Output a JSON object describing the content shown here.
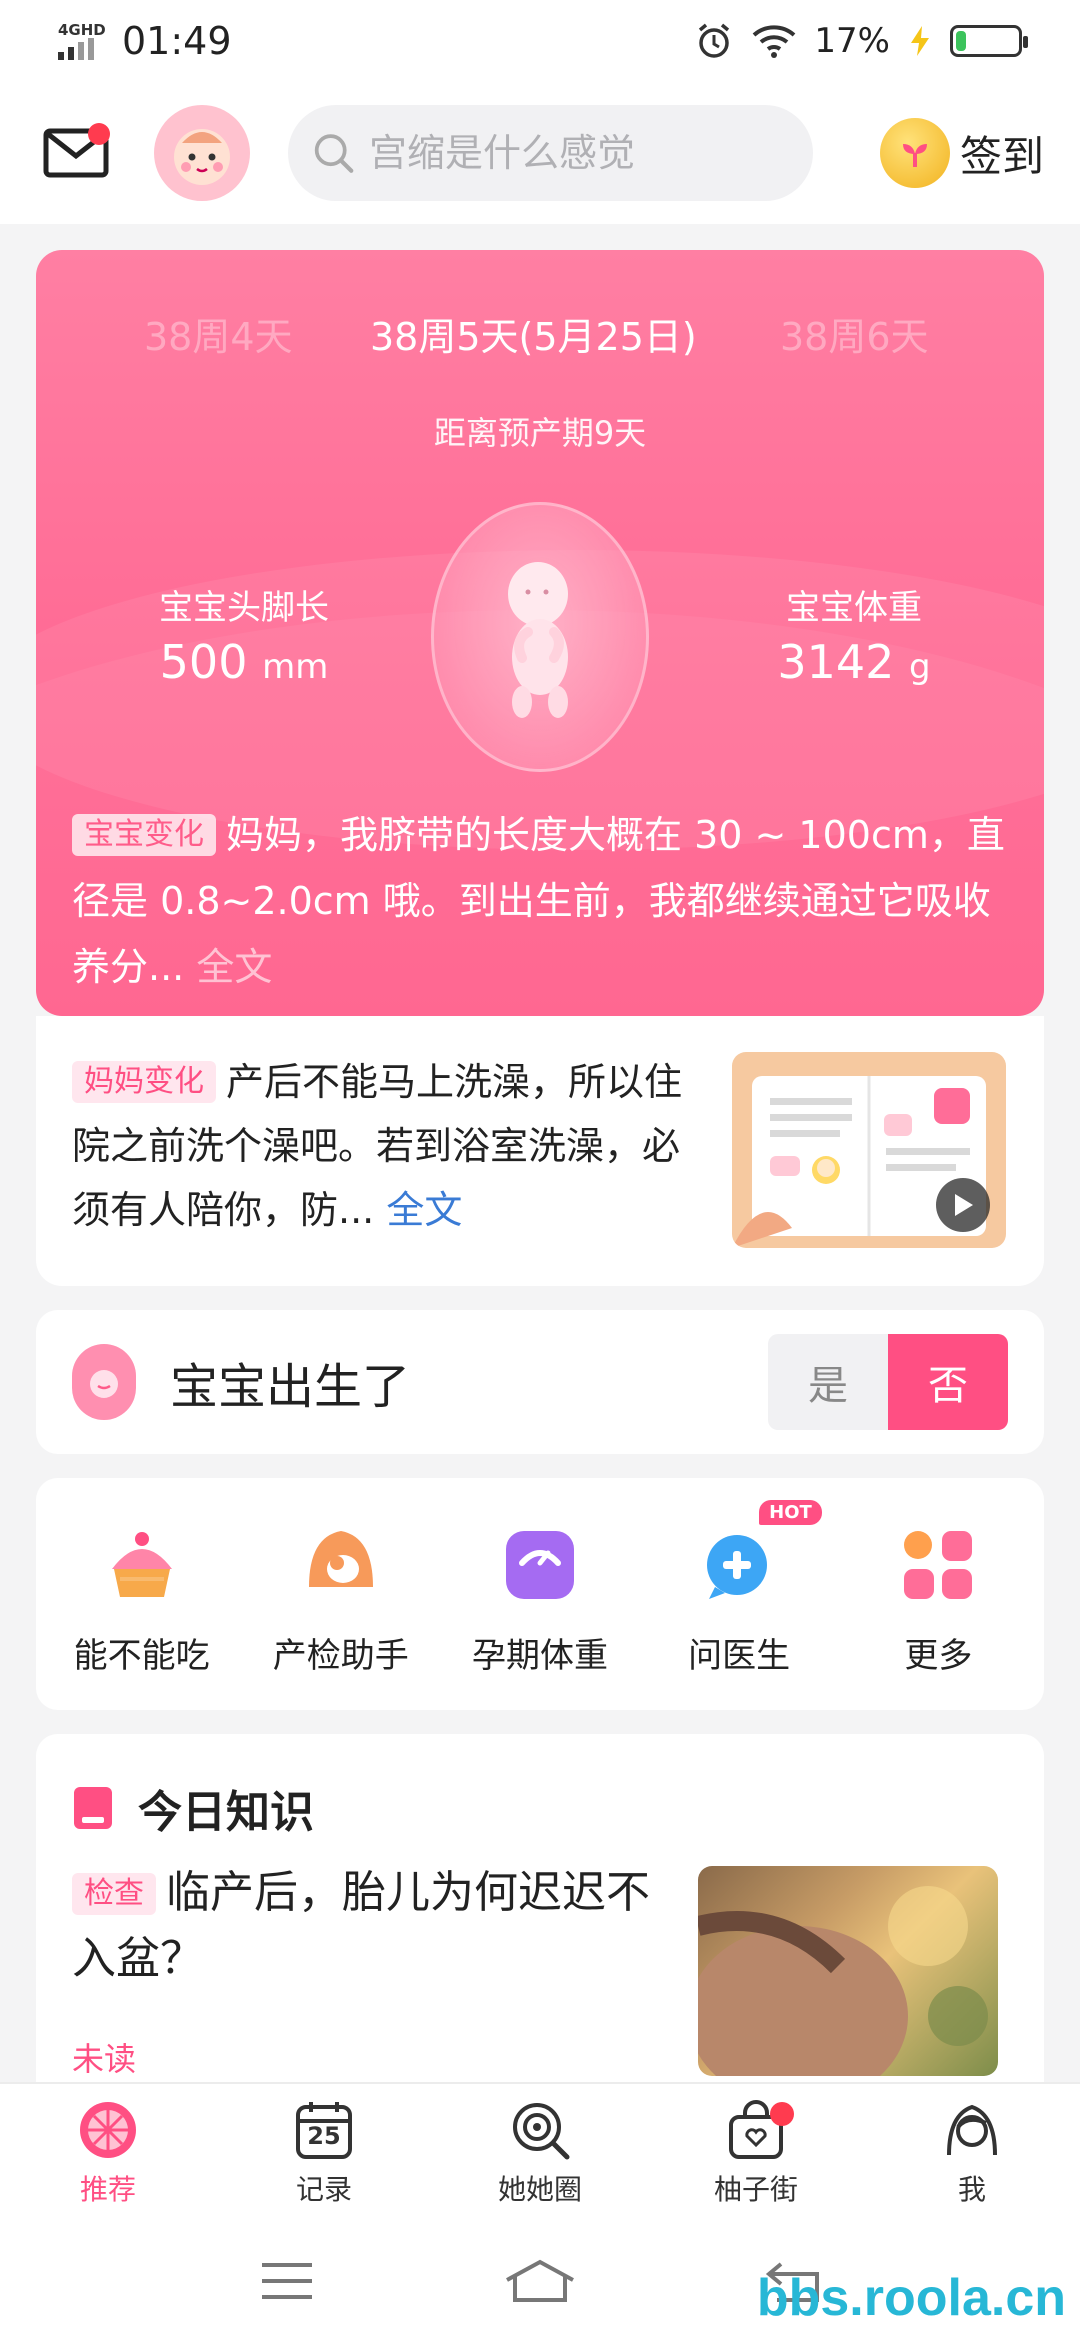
{
  "status_bar": {
    "network": "4GHD",
    "time": "01:49",
    "battery_percent": "17%",
    "battery_level": 0.17
  },
  "header": {
    "search_placeholder": "宫缩是什么感觉",
    "checkin_label": "签到"
  },
  "hero": {
    "prev_week": "38周4天",
    "current_week": "38周5天(5月25日)",
    "next_week": "38周6天",
    "due_countdown": "距离预产期9天",
    "length_label": "宝宝头脚长",
    "length_value": "500",
    "length_unit": "mm",
    "weight_label": "宝宝体重",
    "weight_value": "3142",
    "weight_unit": "g",
    "tag": "宝宝变化",
    "text": "妈妈，我脐带的长度大概在 30 ~ 100cm，直径是 0.8~2.0cm 哦。到出生前，我都继续通过它吸收养分...",
    "more": "全文"
  },
  "mom_change": {
    "tag": "妈妈变化",
    "text": "产后不能马上洗澡，所以住院之前洗个澡吧。若到浴室洗澡，必须有人陪你，防...",
    "more": "全文"
  },
  "born": {
    "label": "宝宝出生了",
    "yes": "是",
    "no": "否"
  },
  "tools": [
    {
      "label": "能不能吃",
      "icon": "cake-icon"
    },
    {
      "label": "产检助手",
      "icon": "ultrasound-icon"
    },
    {
      "label": "孕期体重",
      "icon": "scale-icon"
    },
    {
      "label": "问医生",
      "icon": "doctor-chat-icon",
      "badge": "HOT"
    },
    {
      "label": "更多",
      "icon": "more-grid-icon"
    }
  ],
  "knowledge": {
    "title": "今日知识",
    "tag": "检查",
    "text": "临产后，胎儿为何迟迟不入盆？",
    "status": "未读"
  },
  "tabbar": [
    {
      "label": "推荐",
      "active": true
    },
    {
      "label": "记录",
      "calendar_day": "25"
    },
    {
      "label": "她她圈"
    },
    {
      "label": "柚子街"
    },
    {
      "label": "我"
    }
  ],
  "watermark": "bbs.roola.cn",
  "colors": {
    "accent": "#ff4f83",
    "hero": "#ff6a94",
    "link": "#3a7bd5"
  }
}
